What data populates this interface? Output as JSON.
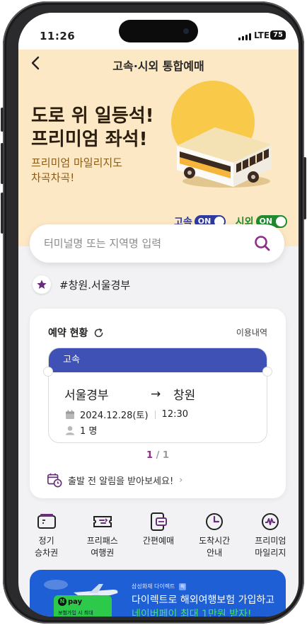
{
  "status_bar": {
    "time": "11:26",
    "network": "LTE",
    "battery": "75"
  },
  "header": {
    "title": "고속·시외 통합예매"
  },
  "hero": {
    "headline_line1": "도로 위 일등석!",
    "headline_line2": "프리미엄 좌석!",
    "sub_line1": "프리미엄 마일리지도",
    "sub_line2": "차곡차곡!"
  },
  "toggles": [
    {
      "label": "고속",
      "state": "ON",
      "label_color": "#2f3aa0",
      "pill_color": "#2f3aa0"
    },
    {
      "label": "시외",
      "state": "ON",
      "label_color": "#1f8a2e",
      "pill_color": "#1f8a2e"
    }
  ],
  "search": {
    "placeholder": "터미널명 또는 지역명 입력",
    "value": ""
  },
  "favorite": {
    "text": "#창원.서울경부"
  },
  "reservation": {
    "title": "예약 현황",
    "history_link": "이용내역",
    "ticket": {
      "type": "고속",
      "departure": "서울경부",
      "arrow": "→",
      "arrival": "창원",
      "date": "2024.12.28(토)",
      "time": "12:30",
      "passengers": "1 명"
    },
    "pager": {
      "current": "1",
      "separator": " / ",
      "total": "1"
    },
    "alarm_text": "출발 전 알림을 받아보세요!",
    "alarm_chevron": "›"
  },
  "quick_menu": [
    {
      "label": "정기\n승차권",
      "icon": "ticket-card-icon"
    },
    {
      "label": "프리패스\n여행권",
      "icon": "freepass-icon"
    },
    {
      "label": "간편예매",
      "icon": "quick-reserve-icon"
    },
    {
      "label": "도착시간\n안내",
      "icon": "clock-icon"
    },
    {
      "label": "프리미엄\n마일리지",
      "icon": "mileage-icon"
    }
  ],
  "banner": {
    "npay_logo": "pay",
    "npay_sub": "보험가입 시 최대",
    "brand": "삼성화재 다이렉트",
    "brand_badge": "착",
    "line1": "다이렉트로 해외여행보험 가입하고",
    "line2": "네이버페이 최대 1만원 받자!",
    "bg_color": "#1e5fd6"
  },
  "colors": {
    "hero_bg": "#fce8c4",
    "accent_purple": "#8e2c8a",
    "ticket_blue": "#3f51b5"
  }
}
